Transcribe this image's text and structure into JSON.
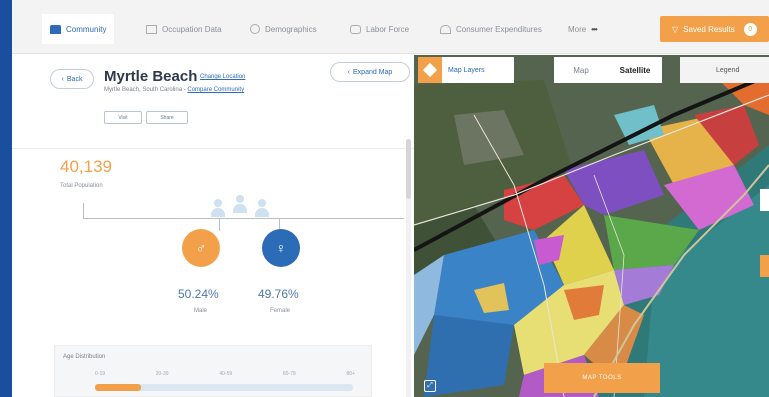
{
  "nav": {
    "tabs": [
      {
        "label": "Community",
        "active": true
      },
      {
        "label": "Occupation Data",
        "active": false
      },
      {
        "label": "Demographics",
        "active": false
      },
      {
        "label": "Labor Force",
        "active": false
      },
      {
        "label": "Consumer Expenditures",
        "active": false
      },
      {
        "label": "More",
        "active": false
      }
    ],
    "saved_label": "Saved Results",
    "saved_count": "0"
  },
  "header": {
    "back_label": "Back",
    "city": "Myrtle Beach",
    "change_location": "Change Location",
    "state": "Myrtle Beach, South Carolina",
    "compare_link": "Compare Community",
    "mini_buttons": [
      "Visit",
      "Share"
    ],
    "expand_label": "Expand Map"
  },
  "population": {
    "value": "40,139",
    "label": "Total Population"
  },
  "gender": {
    "male_pct": "50.24%",
    "male_label": "Male",
    "female_pct": "49.76%",
    "female_label": "Female"
  },
  "age": {
    "title": "Age Distribution",
    "ticks": [
      "0-19",
      "20-39",
      "40-59",
      "60-79",
      "80+"
    ],
    "fill_fraction": 0.18
  },
  "map": {
    "layers_label": "Map Layers",
    "toggle": [
      "Map",
      "Satellite"
    ],
    "active_toggle": "Satellite",
    "legend_label": "Legend",
    "tools_label": "MAP TOOLS",
    "colors": {
      "accent": "#f2a14a",
      "primary": "#2c6bb6"
    }
  }
}
